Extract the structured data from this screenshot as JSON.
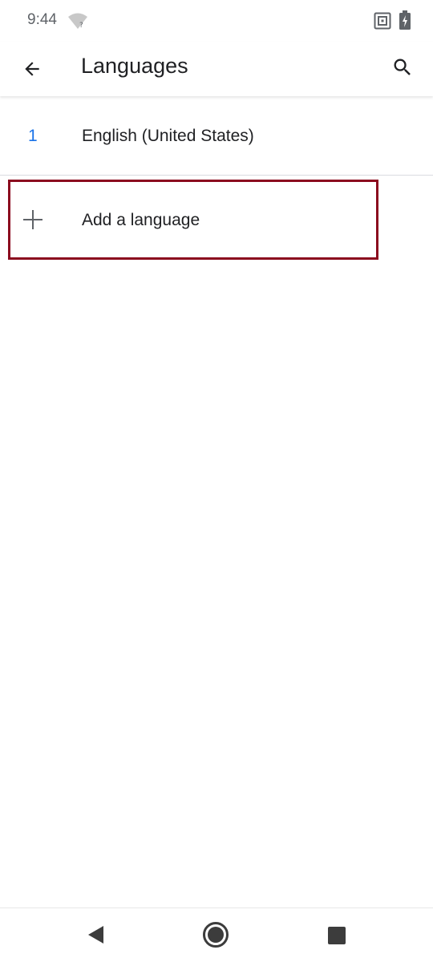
{
  "status_bar": {
    "time": "9:44",
    "icons": [
      "wifi-unknown-icon",
      "nfc-icon",
      "battery-charging-icon"
    ]
  },
  "app_bar": {
    "title": "Languages",
    "back_icon": "arrow-back-icon",
    "search_icon": "search-icon"
  },
  "languages": [
    {
      "index": "1",
      "label": "English (United States)"
    }
  ],
  "add_language": {
    "label": "Add a language",
    "icon": "plus-icon"
  },
  "nav_bar": {
    "icons": [
      "nav-back-icon",
      "nav-home-icon",
      "nav-recents-icon"
    ]
  },
  "colors": {
    "accent": "#1a73e8",
    "highlight_border": "#8b0a1e",
    "text_primary": "#202124",
    "text_secondary": "#5f6368"
  }
}
